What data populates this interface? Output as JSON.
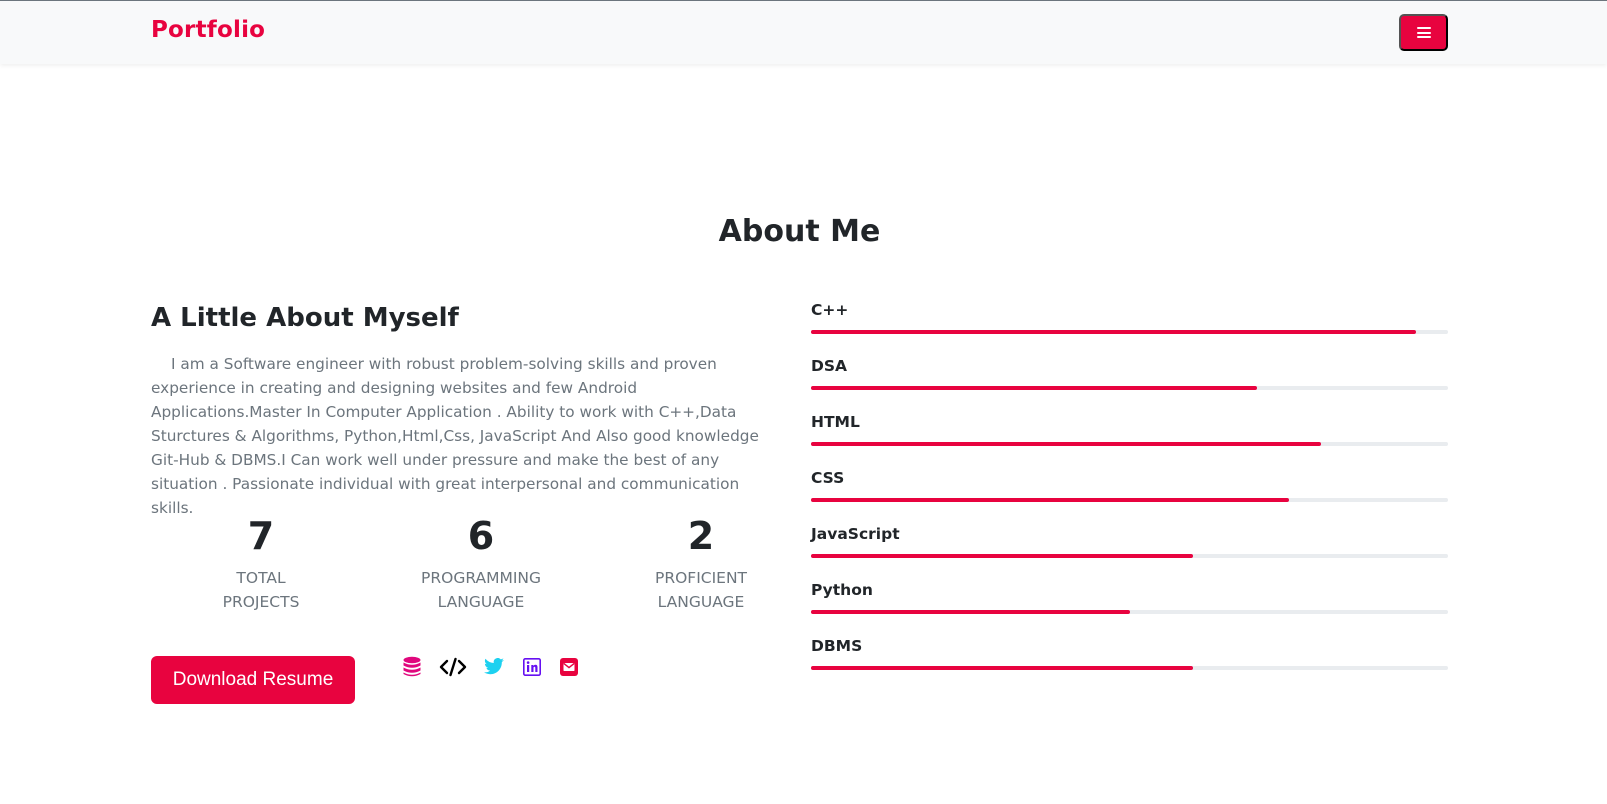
{
  "nav": {
    "brand": "Portfolio",
    "menu_icon": "hamburger-icon",
    "accent": "#e8033f"
  },
  "about": {
    "section_title": "About Me",
    "subtitle": "A Little About Myself",
    "text": "I am a Software engineer with robust problem-solving skills and proven experience in creating and designing websites and few Android Applications.Master In Computer Application . Ability to work with C++,Data Sturctures & Algorithms, Python,Html,Css, JavaScript And Also good knowledge Git-Hub & DBMS.I Can work well under pressure and make the best of any situation . Passionate individual with great interpersonal and communication skills."
  },
  "stats": [
    {
      "number": "7",
      "line1": "TOTAL",
      "line2": "PROJECTS"
    },
    {
      "number": "6",
      "line1": "PROGRAMMING",
      "line2": "LANGUAGE"
    },
    {
      "number": "2",
      "line1": "PROFICIENT",
      "line2": "LANGUAGE"
    }
  ],
  "download_label": "Download Resume",
  "social": [
    {
      "icon": "database-icon",
      "color": "#e0077d"
    },
    {
      "icon": "code-icon",
      "color": "#000000"
    },
    {
      "icon": "twitter-icon",
      "color": "#1dd1f0"
    },
    {
      "icon": "linkedin-icon",
      "color": "#6610f2"
    },
    {
      "icon": "email-icon",
      "color": "#e8033f"
    }
  ],
  "skills": [
    {
      "name": "C++",
      "percent": 95
    },
    {
      "name": "DSA",
      "percent": 70
    },
    {
      "name": "HTML",
      "percent": 80
    },
    {
      "name": "CSS",
      "percent": 75
    },
    {
      "name": "JavaScript",
      "percent": 60
    },
    {
      "name": "Python",
      "percent": 50
    },
    {
      "name": "DBMS",
      "percent": 60
    }
  ]
}
